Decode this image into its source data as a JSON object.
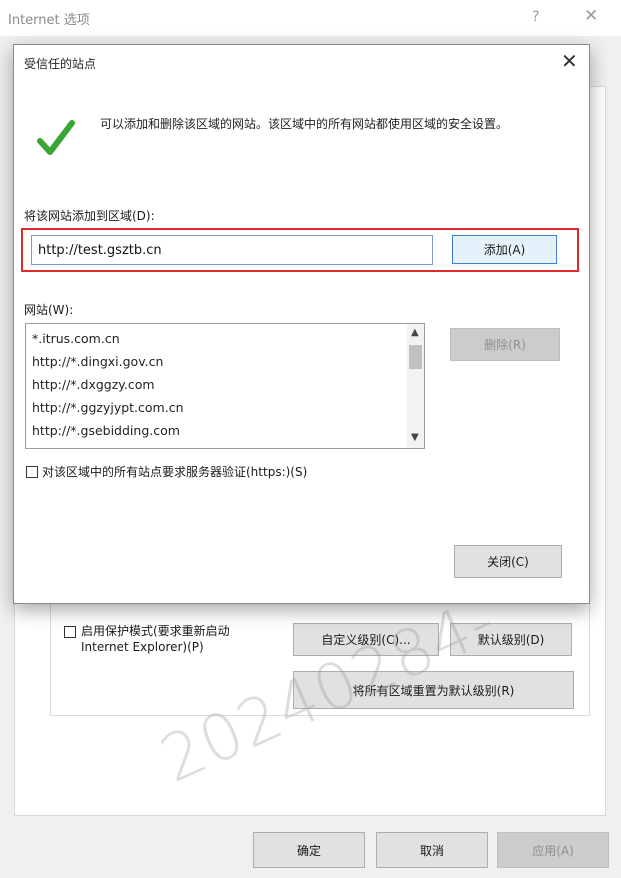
{
  "background_window": {
    "title": "Internet 选项",
    "help_glyph": "?",
    "close_glyph": "✕",
    "protected_mode_label_line1": "启用保护模式(要求重新启动",
    "protected_mode_label_line2": "Internet Explorer)(P)",
    "custom_level_button": "自定义级别(C)...",
    "default_level_button": "默认级别(D)",
    "reset_all_button": "将所有区域重置为默认级别(R)",
    "ok_button": "确定",
    "cancel_button": "取消",
    "apply_button": "应用(A)"
  },
  "dialog": {
    "title": "受信任的站点",
    "close_glyph": "✕",
    "info_text": "可以添加和删除该区域的网站。该区域中的所有网站都使用区域的安全设置。",
    "add_label": "将该网站添加到区域(D):",
    "url_value": "http://test.gsztb.cn",
    "add_button": "添加(A)",
    "websites_label": "网站(W):",
    "websites": [
      "*.itrus.com.cn",
      "http://*.dingxi.gov.cn",
      "http://*.dxggzy.com",
      "http://*.ggzyjypt.com.cn",
      "http://*.gsebidding.com"
    ],
    "remove_button": "删除(R)",
    "https_checkbox_label": "对该区域中的所有站点要求服务器验证(https:)(S)",
    "close_button": "关闭(C)"
  },
  "watermark": "20240284-",
  "colors": {
    "highlight_border": "#e02a2a",
    "check_green": "#3aa535"
  }
}
